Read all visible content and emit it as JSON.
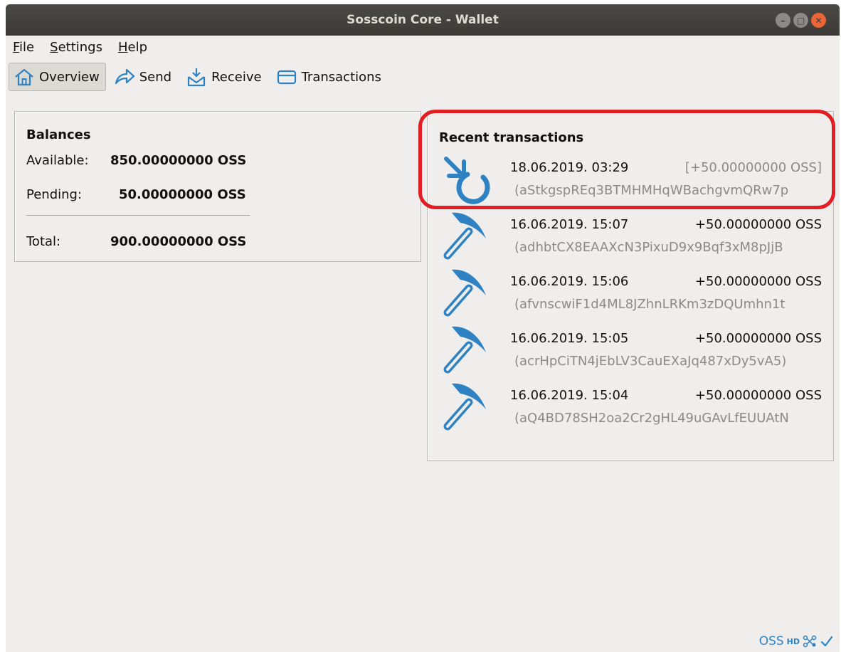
{
  "window": {
    "title": "Sosscoin Core - Wallet"
  },
  "menu": [
    {
      "first": "F",
      "rest": "ile"
    },
    {
      "first": "S",
      "rest": "ettings"
    },
    {
      "first": "H",
      "rest": "elp"
    }
  ],
  "toolbar": {
    "overview": "Overview",
    "send": "Send",
    "receive": "Receive",
    "transactions": "Transactions"
  },
  "balances": {
    "title": "Balances",
    "available_label": "Available:",
    "available_value": "850.00000000 OSS",
    "pending_label": "Pending:",
    "pending_value": "50.00000000 OSS",
    "total_label": "Total:",
    "total_value": "900.00000000 OSS"
  },
  "recent": {
    "title": "Recent transactions",
    "items": [
      {
        "type": "pending-icon",
        "date": "18.06.2019. 03:29",
        "amount": "[+50.00000000 OSS]",
        "address": "(aStkgspREq3BTMHMHqWBachgvmQRw7p"
      },
      {
        "type": "mined-icon",
        "date": "16.06.2019. 15:07",
        "amount": "+50.00000000 OSS",
        "address": "(adhbtCX8EAAXcN3PixuD9x9Bqf3xM8pJjB"
      },
      {
        "type": "mined-icon",
        "date": "16.06.2019. 15:06",
        "amount": "+50.00000000 OSS",
        "address": "(afvnscwiF1d4ML8JZhnLRKm3zDQUmhn1t"
      },
      {
        "type": "mined-icon",
        "date": "16.06.2019. 15:05",
        "amount": "+50.00000000 OSS",
        "address": "(acrHpCiTN4jEbLV3CauEXaJq487xDy5vA5)"
      },
      {
        "type": "mined-icon",
        "date": "16.06.2019. 15:04",
        "amount": "+50.00000000 OSS",
        "address": "(aQ4BD78SH2oa2Cr2gHL49uGAvLfEUUAtN"
      }
    ]
  },
  "status": {
    "unit": "OSS",
    "hd": "HD"
  },
  "colors": {
    "accent": "#2f82c2",
    "highlight": "#e01e24",
    "titlebar": "#3c3b37"
  }
}
